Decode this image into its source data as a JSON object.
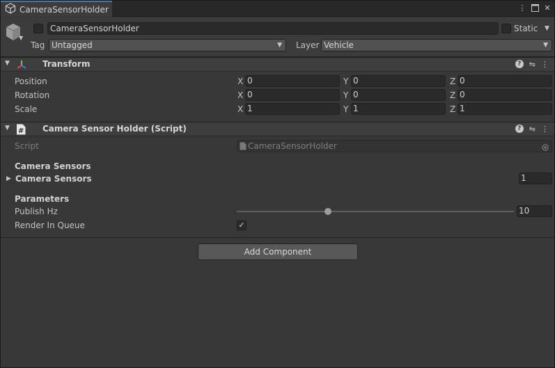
{
  "tab": {
    "title": "CameraSensorHolder"
  },
  "object": {
    "name": "CameraSensorHolder",
    "static_label": "Static",
    "tag_label": "Tag",
    "tag_value": "Untagged",
    "layer_label": "Layer",
    "layer_value": "Vehicle"
  },
  "transform": {
    "title": "Transform",
    "rows": [
      {
        "label": "Position",
        "x": "0",
        "y": "0",
        "z": "0"
      },
      {
        "label": "Rotation",
        "x": "0",
        "y": "0",
        "z": "0"
      },
      {
        "label": "Scale",
        "x": "1",
        "y": "1",
        "z": "1"
      }
    ],
    "axes": {
      "x": "X",
      "y": "Y",
      "z": "Z"
    }
  },
  "script_component": {
    "title": "Camera Sensor Holder (Script)",
    "script_label": "Script",
    "script_value": "CameraSensorHolder",
    "camera_sensors_header": "Camera Sensors",
    "camera_sensors_label": "Camera Sensors",
    "camera_sensors_count": "1",
    "parameters_header": "Parameters",
    "publish_hz_label": "Publish Hz",
    "publish_hz_value": "10",
    "publish_hz_slider_fraction": 0.33,
    "render_in_queue_label": "Render In Queue",
    "render_in_queue_checked": true
  },
  "add_component_label": "Add Component"
}
